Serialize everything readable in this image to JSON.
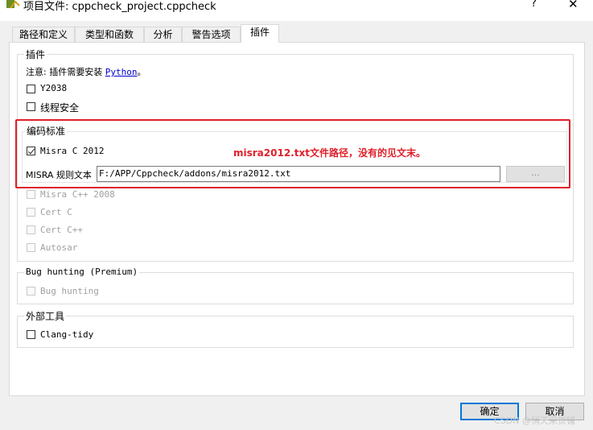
{
  "window": {
    "title": "项目文件: cppcheck_project.cppcheck",
    "help_label": "?",
    "close_label": "✕"
  },
  "tabs": [
    {
      "label": "路径和定义"
    },
    {
      "label": "类型和函数"
    },
    {
      "label": "分析"
    },
    {
      "label": "警告选项"
    },
    {
      "label": "插件",
      "active": true
    }
  ],
  "plugins": {
    "title": "插件",
    "note_prefix": "注意: 插件需要安装 ",
    "note_link": "Python",
    "note_suffix": "。",
    "items": [
      {
        "label": "Y2038",
        "checked": false
      },
      {
        "label": "线程安全",
        "checked": false
      }
    ]
  },
  "coding_standards": {
    "title": "编码标准",
    "misra_c": {
      "label": "Misra C 2012",
      "checked": true
    },
    "rule_text_label": "MISRA 规则文本",
    "rule_text_value": "F:/APP/Cppcheck/addons/misra2012.txt",
    "browse_label": "...",
    "disabled_items": [
      {
        "label": "Misra C++ 2008"
      },
      {
        "label": "Cert C"
      },
      {
        "label": "Cert C++"
      },
      {
        "label": "Autosar"
      }
    ]
  },
  "annotation": {
    "text": "misra2012.txt文件路径，没有的见文末。",
    "color": "#e0202a"
  },
  "bug_hunting": {
    "title": "Bug hunting (Premium)",
    "item": {
      "label": "Bug hunting",
      "checked": false
    }
  },
  "external_tools": {
    "title": "外部工具",
    "item": {
      "label": "Clang-tidy",
      "checked": false
    }
  },
  "buttons": {
    "ok": "确定",
    "cancel": "取消"
  },
  "watermark": "CSDN @悄天采货铺",
  "colors": {
    "accent": "#0078d7",
    "background": "#f0f0f0",
    "panel": "#ffffff"
  }
}
